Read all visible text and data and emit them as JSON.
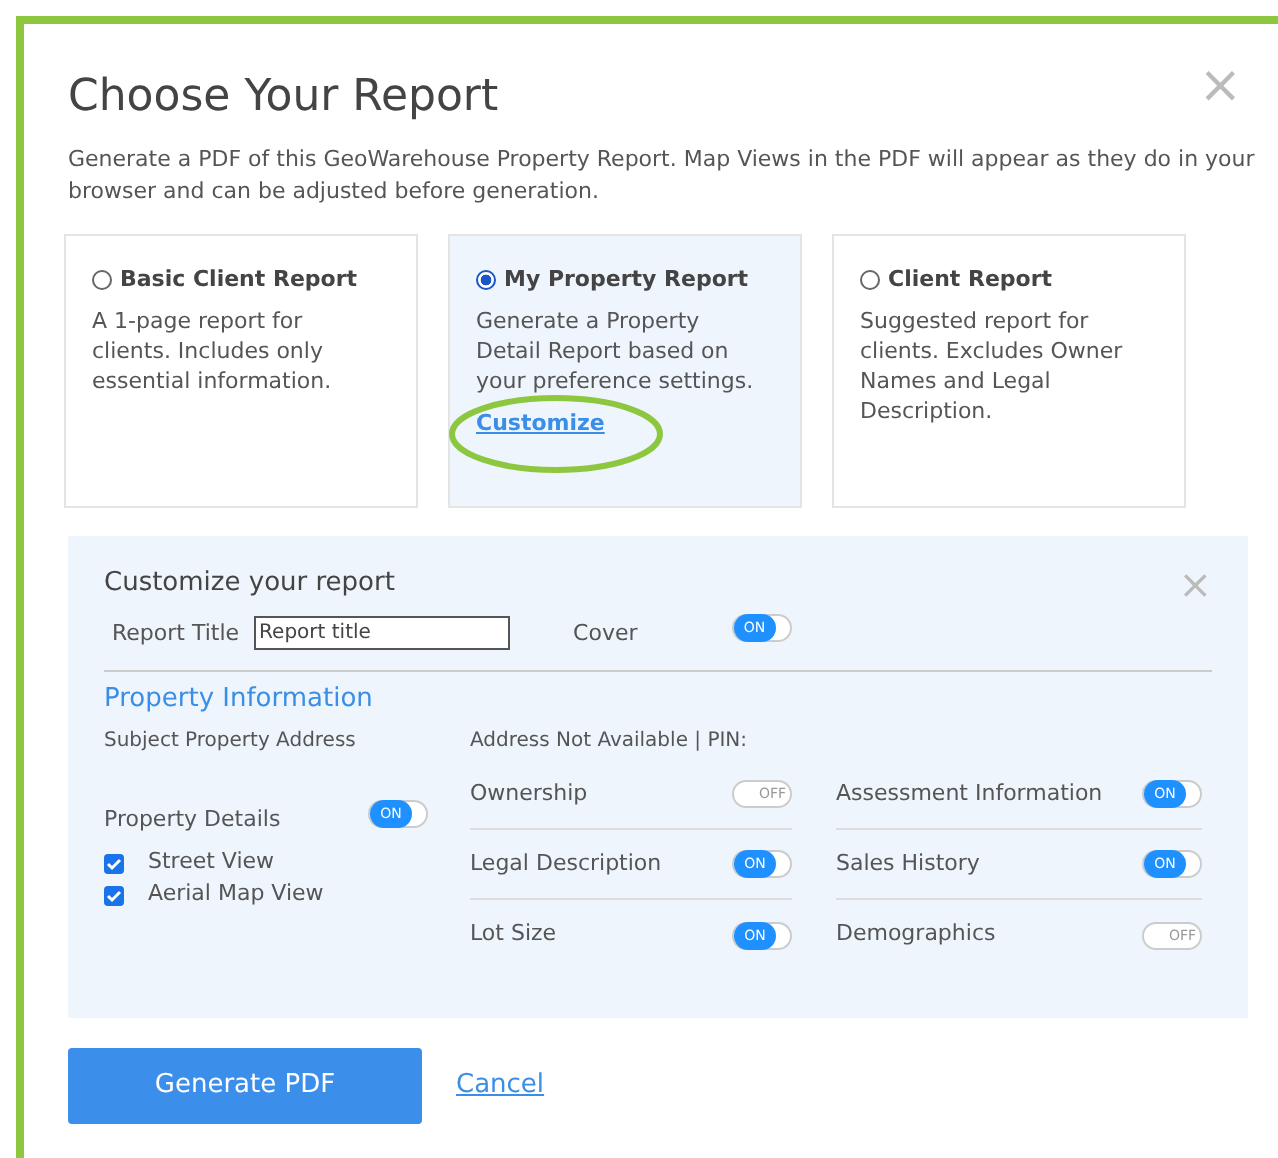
{
  "dialog": {
    "title": "Choose Your Report",
    "close": "×",
    "description": "Generate a PDF of this GeoWarehouse Property Report. Map Views in the PDF will appear as they do in your browser and can be adjusted before generation."
  },
  "report_options": [
    {
      "label": "Basic Client Report",
      "selected": false,
      "description": "A 1-page report for clients. Includes only essential information."
    },
    {
      "label": "My Property Report",
      "selected": true,
      "description": "Generate a Property Detail Report based on your preference settings.",
      "link": "Customize",
      "highlighted": true
    },
    {
      "label": "Client Report",
      "selected": false,
      "description": "Suggested report for clients. Excludes Owner Names and Legal Description."
    }
  ],
  "customize": {
    "title": "Customize your report",
    "close": "×",
    "report_title_label": "Report Title",
    "report_title_value": "Report title",
    "cover": {
      "label": "Cover",
      "on": true,
      "toggle_text": "ON"
    },
    "section_title": "Property Information",
    "address_label": "Subject Property Address",
    "address_value": "Address Not Available | PIN:",
    "property_details": {
      "label": "Property Details",
      "on": true,
      "toggle_text": "ON"
    },
    "checkboxes": [
      {
        "label": "Street View",
        "checked": true
      },
      {
        "label": "Aerial Map View",
        "checked": true
      }
    ],
    "toggles": [
      {
        "label": "Ownership",
        "on": false,
        "toggle_text": "OFF"
      },
      {
        "label": "Assessment Information",
        "on": true,
        "toggle_text": "ON"
      },
      {
        "label": "Legal Description",
        "on": true,
        "toggle_text": "ON"
      },
      {
        "label": "Sales History",
        "on": true,
        "toggle_text": "ON"
      },
      {
        "label": "Lot Size",
        "on": true,
        "toggle_text": "ON"
      },
      {
        "label": "Demographics",
        "on": false,
        "toggle_text": "OFF"
      }
    ]
  },
  "buttons": {
    "primary": "Generate PDF",
    "cancel": "Cancel"
  }
}
